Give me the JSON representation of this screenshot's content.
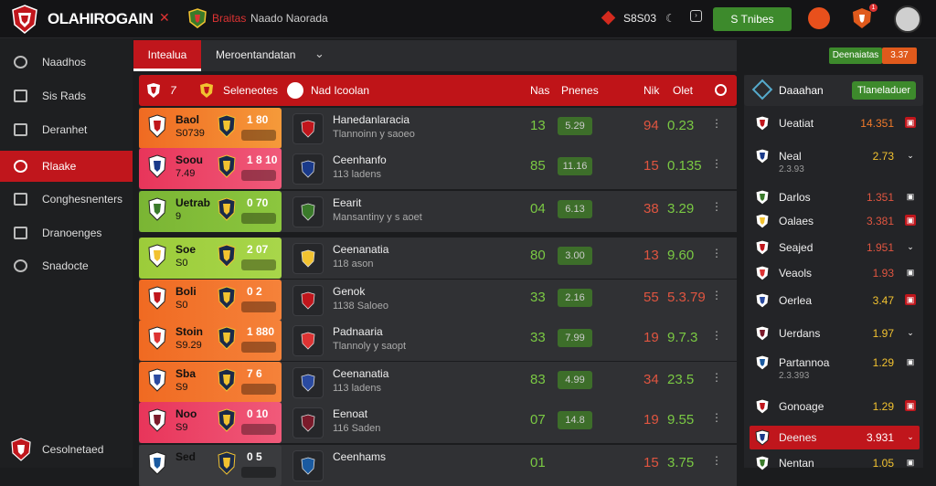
{
  "header": {
    "brand": "OLAHIROGAIN",
    "red_label": "Braitas",
    "nav_label": "Naado Naorada",
    "counter": "S8S03",
    "action_button": "S Tnibes",
    "notification_badge": "1"
  },
  "sidebar": {
    "items": [
      {
        "label": "Naadhos",
        "icon": "soccer-ball-icon"
      },
      {
        "label": "Sis Rads",
        "icon": "board-icon"
      },
      {
        "label": "Deranhet",
        "icon": "ticket-icon"
      },
      {
        "label": "Rlaake",
        "icon": "live-icon",
        "active": true
      },
      {
        "label": "Conghesnenters",
        "icon": "wrench-icon"
      },
      {
        "label": "Dranoenges",
        "icon": "grid-icon"
      },
      {
        "label": "Snadocte",
        "icon": "pin-icon"
      }
    ],
    "footer_label": "Cesolnetaed"
  },
  "tabs": {
    "active": "Intealua",
    "dropdown": "Meroentandatan"
  },
  "table_header": {
    "team_col": "Seleneotes",
    "match_col": "Nad Icoolan",
    "col_a": "Nas",
    "col_b": "Pnenes",
    "col_c": "Nik",
    "col_d": "Olet"
  },
  "rows": [
    {
      "team": "Baol",
      "team_sub": "S0739",
      "score": "1 80",
      "match": "Hanedanlaracia",
      "match_sub": "Tlannoinn y saoeo",
      "g": "13",
      "gp": "5.29",
      "r": "94",
      "odd": "0.23",
      "odd_color": "#7ac943",
      "lbg": "linear-gradient(90deg,#f06a22,#f59a3a)"
    },
    {
      "team": "Soou",
      "team_sub": "7.49",
      "score": "1 8 10",
      "match": "Ceenhanfo",
      "match_sub": "113 ladens",
      "g": "85",
      "gp": "11.16",
      "r": "15",
      "odd": "0.135",
      "odd_color": "#7ac943",
      "lbg": "linear-gradient(90deg,#e8355a,#f05a7a)"
    },
    {
      "team": "Uetrab",
      "team_sub": "9",
      "score": "0 70",
      "match": "Eearit",
      "match_sub": "Mansantiny y s aoet",
      "g": "04",
      "gp": "6.13",
      "r": "38",
      "odd": "3.29",
      "odd_color": "#7ac943",
      "lbg": "linear-gradient(90deg,#7ab534,#8cc63e)"
    },
    {
      "team": "Soe",
      "team_sub": "S0",
      "score": "2 07",
      "match": "Ceenanatia",
      "match_sub": "118 ason",
      "g": "80",
      "gp": "3.00",
      "r": "13",
      "odd": "9.60",
      "odd_color": "#7ac943",
      "lbg": "linear-gradient(90deg,#9ccc3a,#a8d64a)"
    },
    {
      "team": "Boli",
      "team_sub": "S0",
      "score": "0 2",
      "match": "Genok",
      "match_sub": "1138 Saloeo",
      "g": "33",
      "gp": "2.16",
      "r": "55",
      "odd": "5.3.79",
      "odd_color": "#e05540",
      "lbg": "linear-gradient(90deg,#f06a22,#f5823a)"
    },
    {
      "team": "Stoin",
      "team_sub": "S9.29",
      "score": "1 880",
      "match": "Padnaaria",
      "match_sub": "Tlannoly y saopt",
      "g": "33",
      "gp": "7.99",
      "r": "19",
      "odd": "9.7.3",
      "odd_color": "#7ac943",
      "lbg": "linear-gradient(90deg,#f06a22,#f5823a)"
    },
    {
      "team": "Sba",
      "team_sub": "S9",
      "score": "7 6",
      "match": "Ceenanatia",
      "match_sub": "113 ladens",
      "g": "83",
      "gp": "4.99",
      "r": "34",
      "odd": "23.5",
      "odd_color": "#7ac943",
      "lbg": "linear-gradient(90deg,#f06a22,#f5823a)"
    },
    {
      "team": "Noo",
      "team_sub": "S9",
      "score": "0 10",
      "match": "Eenoat",
      "match_sub": "116 Saden",
      "g": "07",
      "gp": "14.8",
      "r": "19",
      "odd": "9.55",
      "odd_color": "#7ac943",
      "lbg": "linear-gradient(90deg,#e8355a,#f05a7a)"
    },
    {
      "team": "Sed",
      "team_sub": "",
      "score": "0 5",
      "match": "Ceenhams",
      "match_sub": "",
      "g": "01",
      "gp": "",
      "r": "15",
      "odd": "3.75",
      "odd_color": "#7ac943",
      "lbg": "linear-gradient(90deg,#3a3b3e,#3a3b3e)"
    }
  ],
  "right_panel": {
    "head_green": "Deenaiatas",
    "head_orange": "3.37",
    "title": "Daaahan",
    "button": "Tlaneladuer",
    "items": [
      {
        "name": "Ueatiat",
        "sub": "",
        "val": "14.351",
        "color": "#f07a2a"
      },
      {
        "name": "Neal",
        "sub": "2.3.93",
        "val": "2.73",
        "color": "#f2c230"
      },
      {
        "name": "Darlos",
        "sub": "",
        "val": "1.351",
        "color": "#e05540"
      },
      {
        "name": "Oalaes",
        "sub": "",
        "val": "3.381",
        "color": "#e05540"
      },
      {
        "name": "Seajed",
        "sub": "",
        "val": "1.951",
        "color": "#e05540"
      },
      {
        "name": "Veaols",
        "sub": "",
        "val": "1.93",
        "color": "#e05540"
      },
      {
        "name": "Oerlea",
        "sub": "",
        "val": "3.47",
        "color": "#f2c230"
      },
      {
        "name": "Uerdans",
        "sub": "",
        "val": "1.97",
        "color": "#f2c230"
      },
      {
        "name": "Partannoa",
        "sub": "2.3.393",
        "val": "1.29",
        "color": "#f2c230"
      },
      {
        "name": "Gonoage",
        "sub": "",
        "val": "1.29",
        "color": "#f2c230"
      },
      {
        "name": "Deenes",
        "sub": "",
        "val": "3.931",
        "color": "#fff",
        "active": true
      },
      {
        "name": "Nentan",
        "sub": "",
        "val": "1.05",
        "color": "#f2c230"
      }
    ]
  }
}
